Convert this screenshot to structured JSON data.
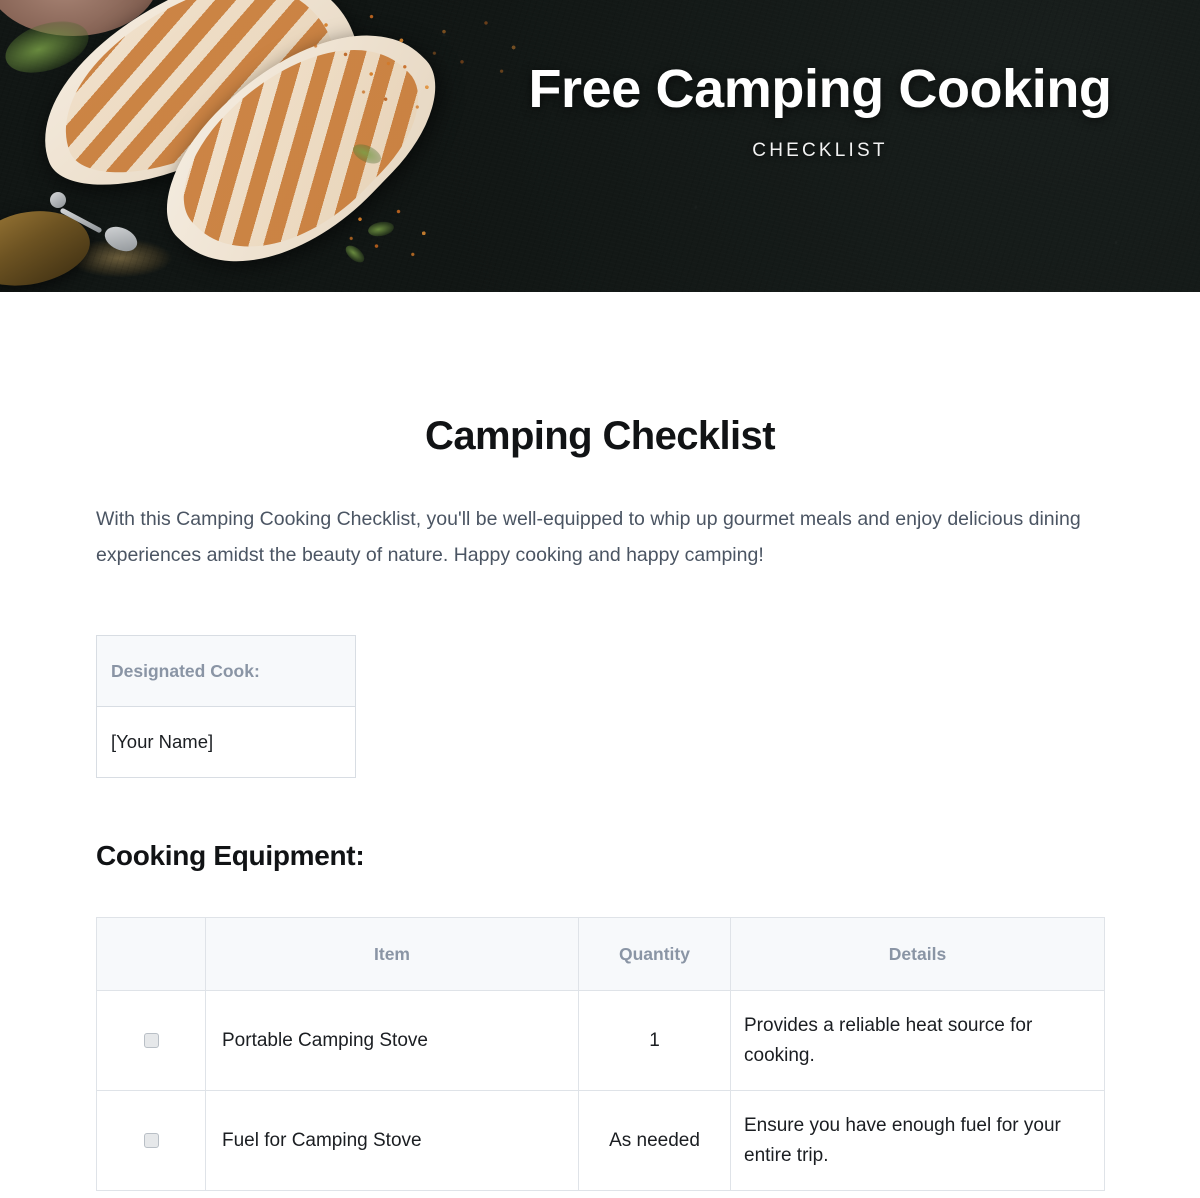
{
  "hero": {
    "title": "Free Camping Cooking",
    "subtitle": "CHECKLIST",
    "photo_alt": "grilled-chicken-on-slate",
    "background_color": "#14191a"
  },
  "document": {
    "page_title": "Camping Checklist",
    "intro": "With this Camping Cooking Checklist, you'll be well-equipped to whip up gourmet meals and enjoy delicious dining experiences amidst the beauty of nature. Happy cooking and happy camping!"
  },
  "cook_table": {
    "header": "Designated Cook:",
    "value": "[Your Name]"
  },
  "equipment": {
    "section_title": "Cooking Equipment:",
    "columns": [
      "",
      "Item",
      "Quantity",
      "Details"
    ],
    "rows": [
      {
        "checked": false,
        "item": "Portable Camping Stove",
        "quantity": "1",
        "details": "Provides a reliable heat source for cooking."
      },
      {
        "checked": false,
        "item": "Fuel for Camping Stove",
        "quantity": "As needed",
        "details": "Ensure you have enough fuel for your entire trip."
      }
    ]
  },
  "colors": {
    "heading": "#111315",
    "body_text": "#4b5563",
    "muted_label": "#8a95a5",
    "table_header_bg": "#f7f9fb",
    "border": "#dfe3e8"
  }
}
